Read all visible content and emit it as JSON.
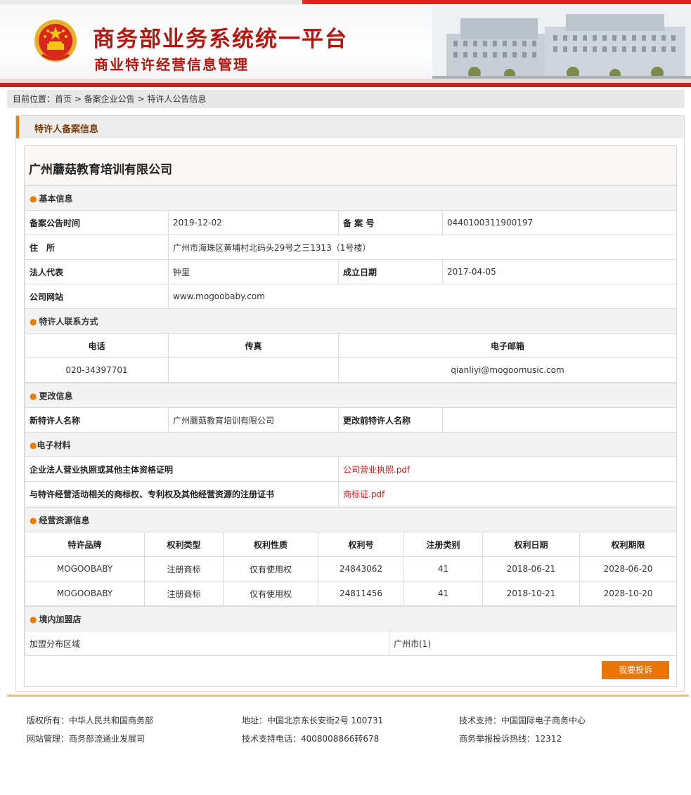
{
  "header": {
    "title_main": "商务部业务系统统一平台",
    "title_sub": "商业特许经营信息管理"
  },
  "breadcrumb": "目前位置：首页 > 备案企业公告 > 特许人公告信息",
  "panel_title": "特许人备案信息",
  "company_name": "广州蘑菇教育培训有限公司",
  "basic": {
    "section": "基本信息",
    "filing_date_label": "备案公告时间",
    "filing_date": "2019-12-02",
    "record_no_label": "备 案 号",
    "record_no": "0440100311900197",
    "address_label": "住　所",
    "address": "广州市海珠区黄埔村北码头29号之三1313（1号楼）",
    "legal_rep_label": "法人代表",
    "legal_rep": "钟里",
    "founded_label": "成立日期",
    "founded": "2017-04-05",
    "website_label": "公司网站",
    "website": "www.mogoobaby.com"
  },
  "contact": {
    "section": "特许人联系方式",
    "phone_label": "电话",
    "fax_label": "传真",
    "email_label": "电子邮箱",
    "phone": "020-34397701",
    "fax": "",
    "email": "qianliyi@mogoomusic.com"
  },
  "change": {
    "section": "更改信息",
    "new_name_label": "新特许人名称",
    "new_name": "广州蘑菇教育培训有限公司",
    "old_name_label": "更改前特许人名称",
    "old_name": ""
  },
  "materials": {
    "section": "电子材料",
    "license_label": "企业法人营业执照或其他主体资格证明",
    "license_file": "公司营业执照.pdf",
    "cert_label": "与特许经营活动相关的商标权、专利权及其他经营资源的注册证书",
    "cert_file": "商标证.pdf"
  },
  "resources": {
    "section": "经营资源信息",
    "headers": [
      "特许品牌",
      "权利类型",
      "权利性质",
      "权利号",
      "注册类别",
      "权利日期",
      "权利期限"
    ],
    "rows": [
      [
        "MOGOOBABY",
        "注册商标",
        "仅有使用权",
        "24843062",
        "41",
        "2018-06-21",
        "2028-06-20"
      ],
      [
        "MOGOOBABY",
        "注册商标",
        "仅有使用权",
        "24811456",
        "41",
        "2018-10-21",
        "2028-10-20"
      ]
    ]
  },
  "stores": {
    "section": "境内加盟店",
    "region_label": "加盟分布区域",
    "region": "广州市(1)"
  },
  "complain_button": "我要投诉",
  "footer": {
    "copyright": "版权所有：中华人民共和国商务部",
    "address": "地址：中国北京东长安街2号 100731",
    "tech_support": "技术支持：中国国际电子商务中心",
    "site_admin": "网站管理：商务部流通业发展司",
    "tech_phone": "技术支持电话：4008008866转678",
    "hotline": "商务举报投诉热线：12312"
  }
}
